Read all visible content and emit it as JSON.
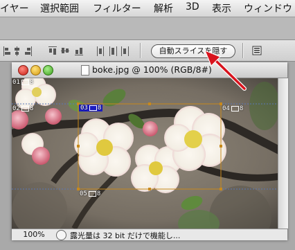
{
  "menubar": {
    "items": [
      "イヤー",
      "選択範囲",
      "フィルター",
      "解析",
      "3D",
      "表示",
      "ウィンドウ"
    ]
  },
  "optionsbar": {
    "auto_slices_button": "自動スライスを隠す"
  },
  "document": {
    "title": "boke.jpg @ 100% (RGB/8#)",
    "zoom": "100%",
    "status": "露光量は 32 bit だけで機能し..."
  },
  "slices": [
    {
      "num": "01",
      "suffix": "8"
    },
    {
      "num": "02",
      "suffix": "8"
    },
    {
      "num": "03",
      "suffix": "8"
    },
    {
      "num": "04",
      "suffix": "8"
    },
    {
      "num": "05",
      "suffix": "8"
    }
  ],
  "colors": {
    "annotation_arrow": "#d8141e",
    "selected_slice_label": "#1c1cc0",
    "slice_bounding_box": "#c8891c",
    "slice_lines": "#5a78b8"
  }
}
